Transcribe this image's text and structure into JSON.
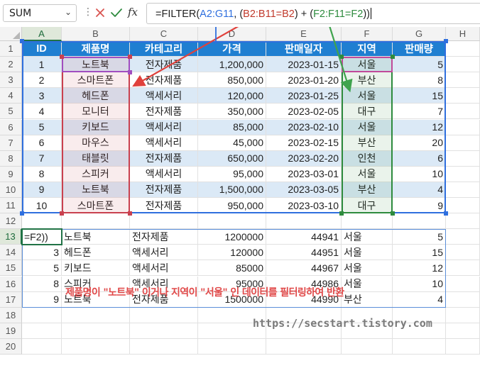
{
  "formula_bar": {
    "name_box": "SUM",
    "fx": "fx",
    "formula": {
      "p1": "=FILTER(",
      "p2": "A2:G11",
      "p3": ", (",
      "p4": "B2:B11=B2",
      "p5": ")  +  (",
      "p6": "F2:F11=F2",
      "p7": "))"
    }
  },
  "columns": [
    "A",
    "B",
    "C",
    "D",
    "E",
    "F",
    "G",
    "H"
  ],
  "rows": [
    "1",
    "2",
    "3",
    "4",
    "5",
    "6",
    "7",
    "8",
    "9",
    "10",
    "11",
    "12",
    "13",
    "14",
    "15",
    "16",
    "17",
    "18",
    "19",
    "20"
  ],
  "table_headers": [
    "ID",
    "제품명",
    "카테고리",
    "가격",
    "판매일자",
    "지역",
    "판매량"
  ],
  "table_rows": [
    [
      "1",
      "노트북",
      "전자제품",
      "1,200,000",
      "2023-01-15",
      "서울",
      "5"
    ],
    [
      "2",
      "스마트폰",
      "전자제품",
      "850,000",
      "2023-01-20",
      "부산",
      "8"
    ],
    [
      "3",
      "헤드폰",
      "액세서리",
      "120,000",
      "2023-01-25",
      "서울",
      "15"
    ],
    [
      "4",
      "모니터",
      "전자제품",
      "350,000",
      "2023-02-05",
      "대구",
      "7"
    ],
    [
      "5",
      "키보드",
      "액세서리",
      "85,000",
      "2023-02-10",
      "서울",
      "12"
    ],
    [
      "6",
      "마우스",
      "액세서리",
      "45,000",
      "2023-02-15",
      "부산",
      "20"
    ],
    [
      "7",
      "태블릿",
      "전자제품",
      "650,000",
      "2023-02-20",
      "인천",
      "6"
    ],
    [
      "8",
      "스피커",
      "액세서리",
      "95,000",
      "2023-03-01",
      "서울",
      "10"
    ],
    [
      "9",
      "노트북",
      "전자제품",
      "1,500,000",
      "2023-03-05",
      "부산",
      "4"
    ],
    [
      "10",
      "스마트폰",
      "전자제품",
      "950,000",
      "2023-03-10",
      "대구",
      "9"
    ]
  ],
  "result_rows": [
    [
      "=F2))",
      "노트북",
      "전자제품",
      "1200000",
      "44941",
      "서울",
      "5"
    ],
    [
      "3",
      "헤드폰",
      "액세서리",
      "120000",
      "44951",
      "서울",
      "15"
    ],
    [
      "5",
      "키보드",
      "액세서리",
      "85000",
      "44967",
      "서울",
      "12"
    ],
    [
      "8",
      "스피커",
      "액세서리",
      "95000",
      "44986",
      "서울",
      "10"
    ],
    [
      "9",
      "노트북",
      "전자제품",
      "1500000",
      "44990",
      "부산",
      "4"
    ]
  ],
  "caption": "제품명이 \"노트북\" 이거나 지역이 \"서울\" 인 데이터를 필터링하여 반환",
  "watermark": "https://secstart.tistory.com",
  "colors": {
    "header_fill": "#1f7fd1",
    "band_fill": "#dbe9f6",
    "ref_red": "#c0392b",
    "ref_green": "#2e8b3e",
    "ref_blue": "#2f6fde",
    "caption": "#e04848"
  }
}
